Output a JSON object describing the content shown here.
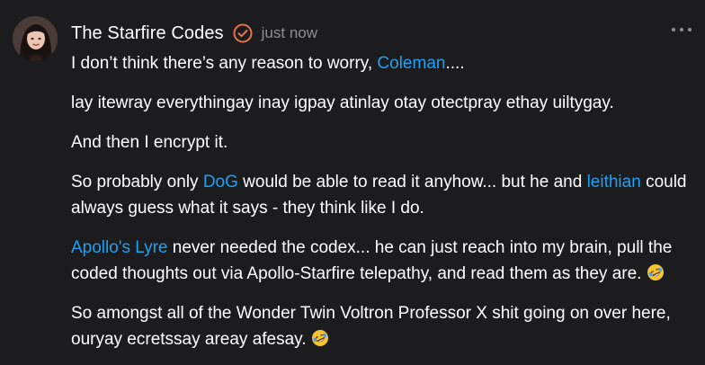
{
  "post": {
    "author": "The Starfire Codes",
    "timestamp": "just now",
    "icons": {
      "verified": "verified-badge-icon",
      "more": "more-options-icon",
      "emoji": "rofl-emoji-icon"
    },
    "colors": {
      "background": "#1c1c1e",
      "text": "#ffffff",
      "muted": "#8e8e93",
      "mention": "#1da1f2",
      "badge": "#e8744a"
    },
    "p1": {
      "before": "I don’t think there’s any reason to worry, ",
      "mention": "Coleman",
      "after": "...."
    },
    "p2": "lay itewray everythingay inay igpay atinlay otay otectpray ethay uiltygay.",
    "p3": "And then I encrypt it.",
    "p4": {
      "before": "So probably only ",
      "mention1": "DoG",
      "middle": " would be able to read it anyhow... but he and ",
      "mention2": "leithian",
      "after": " could always guess what it says - they think like I do."
    },
    "p5": {
      "mention": "Apollo's Lyre",
      "after": " never needed the codex... he can just reach into my brain, pull the coded thoughts out via Apollo-Starfire telepathy, and read them as they are. "
    },
    "p6": {
      "text": "So amongst all of the Wonder Twin Voltron Professor X shit going on over here, ouryay ecretssay areay afesay. "
    }
  }
}
